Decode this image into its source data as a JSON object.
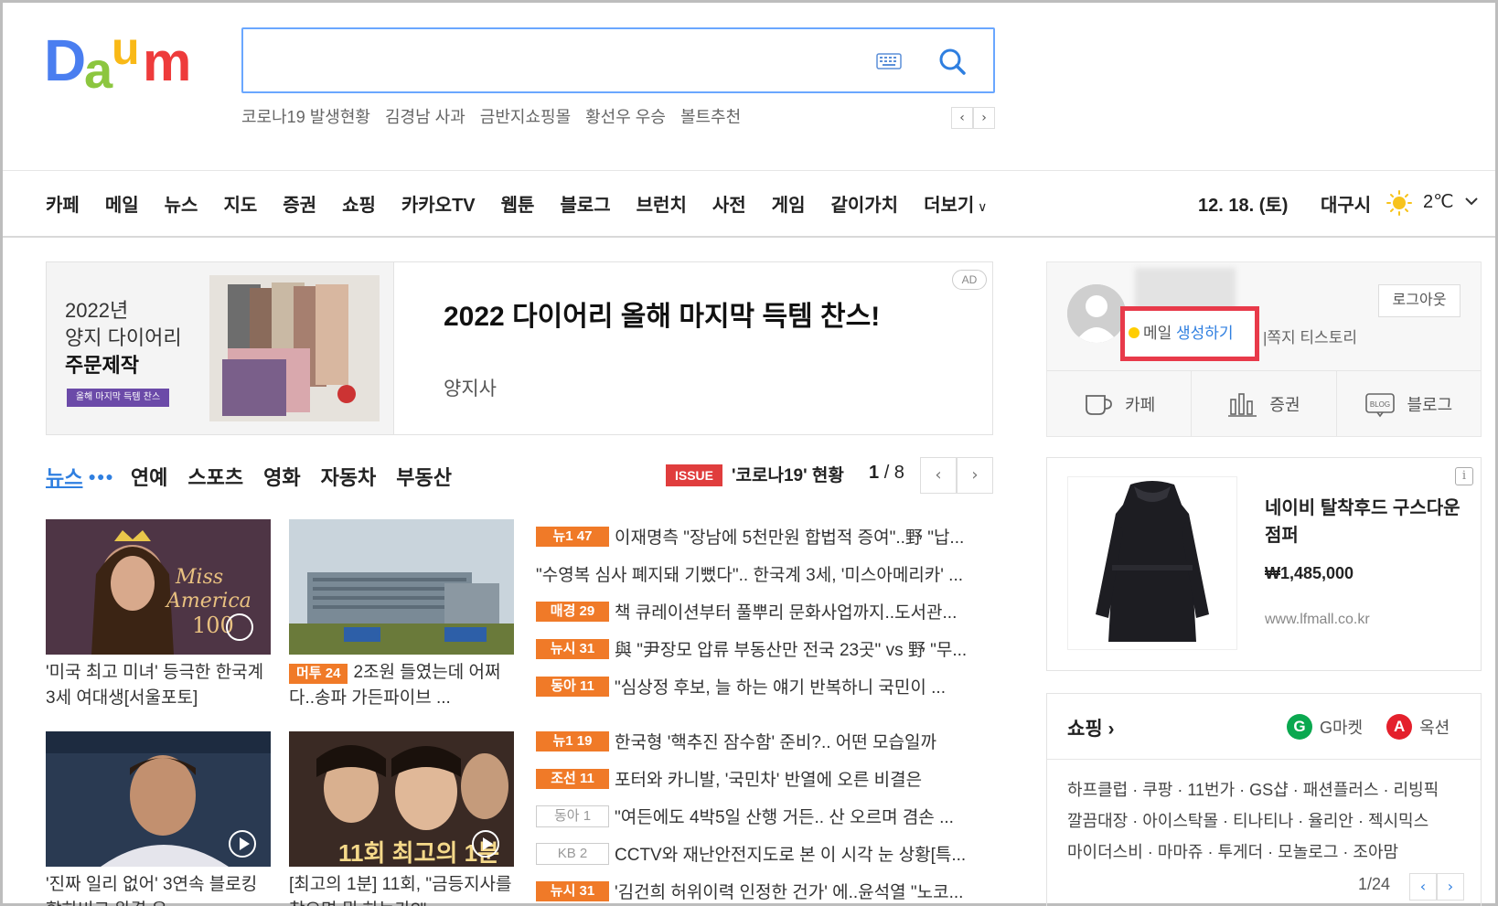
{
  "header": {
    "search_placeholder": "",
    "trends": [
      "코로나19 발생현황",
      "김경남 사과",
      "금반지쇼핑몰",
      "황선우 우승",
      "볼트추천"
    ]
  },
  "nav": {
    "items": [
      "카페",
      "메일",
      "뉴스",
      "지도",
      "증권",
      "쇼핑",
      "카카오TV",
      "웹툰",
      "블로그",
      "브런치",
      "사전",
      "게임",
      "같이가치",
      "더보기"
    ],
    "date": "12. 18. (토)",
    "city": "대구시",
    "temp": "2℃"
  },
  "ad": {
    "left_line1": "2022년",
    "left_line2": "양지 다이어리",
    "left_line3": "주문제작",
    "left_button": "올해 마지막 득템 찬스",
    "title": "2022 다이어리 올해 마지막 득템 찬스!",
    "sub": "양지사",
    "tag": "AD"
  },
  "news": {
    "tabs": [
      "뉴스",
      "연예",
      "스포츠",
      "영화",
      "자동차",
      "부동산"
    ],
    "issue_badge": "ISSUE",
    "issue_text": "'코로나19' 현황",
    "page_current": "1",
    "page_total": "/ 8",
    "cards": [
      {
        "caption": "'미국 최고 미녀' 등극한 한국계 3세 여대생[서울포토]",
        "tag": ""
      },
      {
        "caption": "2조원 들였는데 어쩌다..송파 가든파이브 ...",
        "tag": "머투 24"
      },
      {
        "caption": "'진짜 일리 없어' 3연속 블로킹 합하비크 완결 유...",
        "tag": ""
      },
      {
        "caption": "[최고의 1분] 11회, \"금등지사를 찾으면 뭐 하는가?\"",
        "tag": ""
      }
    ],
    "headlines": [
      {
        "tag": "뉴1 47",
        "style": "orange",
        "text": "이재명측 \"장남에 5천만원 합법적 증여\"..野 \"납..."
      },
      {
        "tag": "",
        "style": "none",
        "text": "\"수영복 심사 폐지돼 기뻤다\".. 한국계 3세, '미스아메리카' ..."
      },
      {
        "tag": "매경 29",
        "style": "orange",
        "text": "책 큐레이션부터 풀뿌리 문화사업까지..도서관..."
      },
      {
        "tag": "뉴시 31",
        "style": "orange",
        "text": "與 \"尹장모 압류 부동산만 전국 23곳\" vs 野 \"무..."
      },
      {
        "tag": "동아 11",
        "style": "orange",
        "text": "\"심상정 후보, 늘 하는 얘기 반복하니 국민이 ..."
      },
      {
        "tag": "뉴1 19",
        "style": "orange",
        "text": "한국형 '핵추진 잠수함' 준비?.. 어떤 모습일까"
      },
      {
        "tag": "조선 11",
        "style": "orange",
        "text": "포터와 카니발, '국민차' 반열에 오른 비결은"
      },
      {
        "tag": "동아 1",
        "style": "gray",
        "text": "\"여든에도 4박5일 산행 거든.. 산 오르며 겸손 ..."
      },
      {
        "tag": "KB 2",
        "style": "gray",
        "text": "CCTV와 재난안전지도로 본 이 시각 눈 상황[특..."
      },
      {
        "tag": "뉴시 31",
        "style": "orange",
        "text": "'김건희 허위이력 인정한 건가' 에..윤석열 \"노코..."
      }
    ]
  },
  "login": {
    "logout": "로그아웃",
    "mail_prefix": "메일 ",
    "mail_action": "생성하기",
    "sublinks": "|쪽지  티스토리",
    "services": [
      "카페",
      "증권",
      "블로그"
    ]
  },
  "product": {
    "title": "네이비 탈착후드 구스다운점퍼",
    "price": "₩1,485,000",
    "site": "www.lfmall.co.kr",
    "info": "i"
  },
  "shopping": {
    "title": "쇼핑 ›",
    "gmarket": "G마켓",
    "auction": "옥션",
    "line1": "하프클럽 · 쿠팡 · 11번가 · GS샵 · 패션플러스 · 리빙픽",
    "line2": "깔끔대장 · 아이스탁몰 · 티나티나 · 율리안 · 젝시믹스",
    "line3": "마이더스비 · 마마쥬 · 투게더 · 모놀로그 · 조아맘",
    "page": "1/24"
  },
  "colors": {
    "accent": "#2f7fe0",
    "tag_orange": "#f07a28",
    "issue_red": "#e03d3d",
    "highlight_red": "#e83a4a"
  }
}
